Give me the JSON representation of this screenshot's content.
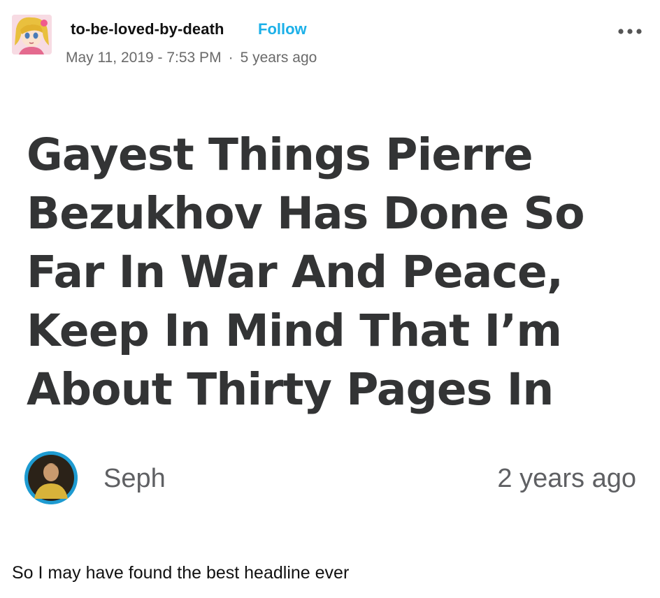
{
  "post": {
    "username": "to-be-loved-by-death",
    "follow_label": "Follow",
    "date": "May 11, 2019 - 7:53 PM",
    "separator": "·",
    "relative_time": "5 years ago",
    "more_icon": "ellipsis-horizontal-icon"
  },
  "image": {
    "headline": "Gayest Things Pierre Bezukhov Has Done So Far In War And Peace, Keep In Mind That I’m About Thirty Pages In",
    "author_name": "Seph",
    "author_time": "2 years ago"
  },
  "caption": "So I may have found the best headline ever",
  "colors": {
    "follow": "#1cb0e8",
    "headline_text": "#333435",
    "author_ring": "#1e9bd1"
  }
}
